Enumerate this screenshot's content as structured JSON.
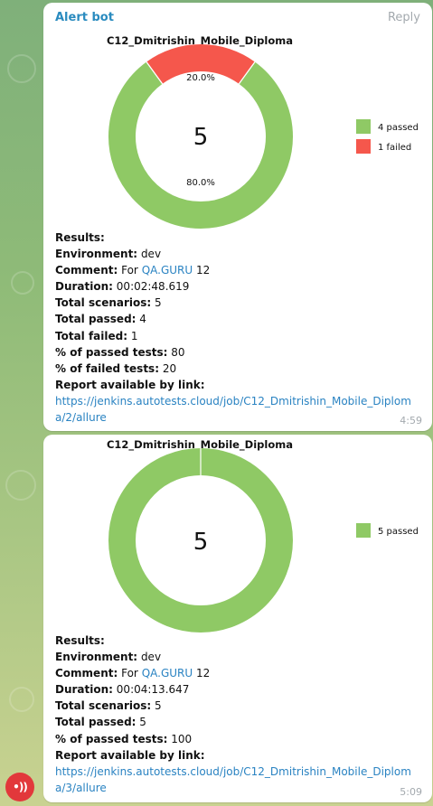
{
  "messages": [
    {
      "sender": "Alert bot",
      "reply_label": "Reply",
      "time": "4:59",
      "chart_data": {
        "type": "pie",
        "title": "C12_Dmitrishin_Mobile_Diploma",
        "center_value": "5",
        "slices": [
          {
            "label": "4 passed",
            "value": 80.0,
            "pct_label": "80.0%",
            "color": "#8fc965"
          },
          {
            "label": "1 failed",
            "value": 20.0,
            "pct_label": "20.0%",
            "color": "#f5574c"
          }
        ],
        "legend_placement": "right"
      },
      "results": {
        "heading": "Results:",
        "rows": [
          {
            "label": "Environment:",
            "value": "dev"
          },
          {
            "label": "Comment:",
            "value": "For ",
            "link": "QA.GURU",
            "after": " 12"
          },
          {
            "label": "Duration:",
            "value": "00:02:48.619"
          },
          {
            "label": "Total scenarios:",
            "value": "5"
          },
          {
            "label": "Total passed:",
            "value": "4"
          },
          {
            "label": "Total failed:",
            "value": "1"
          },
          {
            "label": "% of passed tests:",
            "value": "80"
          },
          {
            "label": "% of failed tests:",
            "value": "20"
          }
        ],
        "report_label": "Report available by link:",
        "report_url_line1": "https://jenkins.autotests.cloud/job/C12_Dmitrishin_Mobile_Diplom",
        "report_url_line2": "a/2/allure"
      }
    },
    {
      "time": "5:09",
      "chart_data": {
        "type": "pie",
        "title": "C12_Dmitrishin_Mobile_Diploma",
        "center_value": "5",
        "slices": [
          {
            "label": "5 passed",
            "value": 100.0,
            "pct_label": "",
            "color": "#8fc965"
          }
        ],
        "legend_placement": "right"
      },
      "results": {
        "heading": "Results:",
        "rows": [
          {
            "label": "Environment:",
            "value": "dev"
          },
          {
            "label": "Comment:",
            "value": "For ",
            "link": "QA.GURU",
            "after": " 12"
          },
          {
            "label": "Duration:",
            "value": "00:04:13.647"
          },
          {
            "label": "Total scenarios:",
            "value": "5"
          },
          {
            "label": "Total passed:",
            "value": "5"
          },
          {
            "label": "% of passed tests:",
            "value": "100"
          }
        ],
        "report_label": "Report available by link:",
        "report_url_line1": "https://jenkins.autotests.cloud/job/C12_Dmitrishin_Mobile_Diplom",
        "report_url_line2": "a/3/allure"
      }
    }
  ],
  "avatar_icon": "broadcast-icon"
}
